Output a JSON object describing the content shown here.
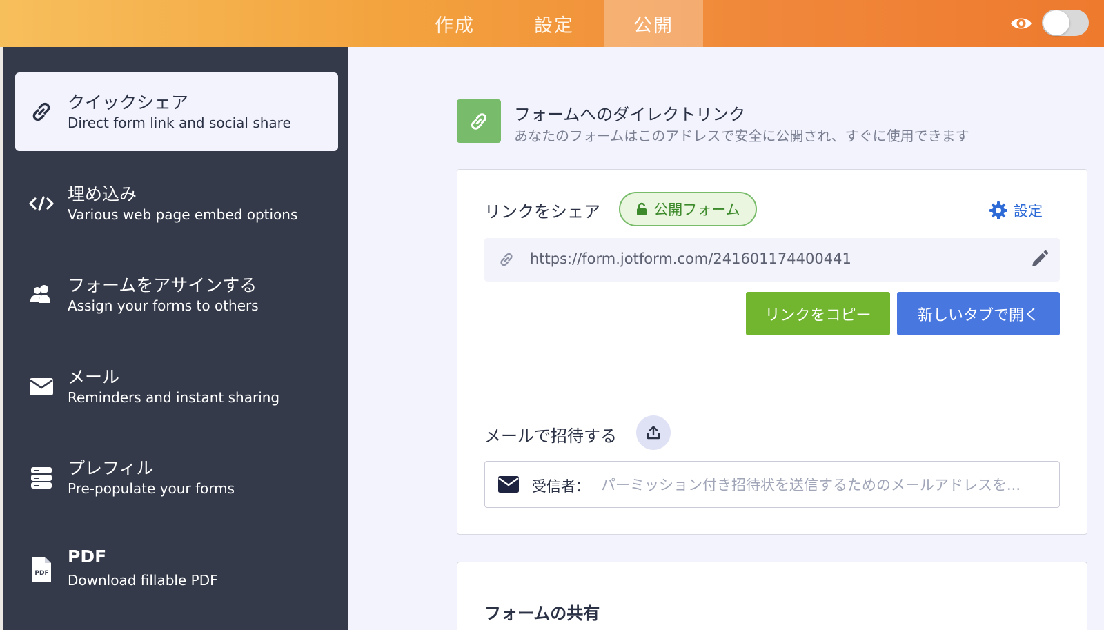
{
  "topbar": {
    "tabs": [
      {
        "label": "作成",
        "active": false
      },
      {
        "label": "設定",
        "active": false
      },
      {
        "label": "公開",
        "active": true
      }
    ],
    "preview_icon": "eye-icon",
    "toggle_on": false
  },
  "sidebar": {
    "items": [
      {
        "title": "クイックシェア",
        "desc": "Direct form link and social share",
        "icon": "link-icon",
        "active": true
      },
      {
        "title": "埋め込み",
        "desc": "Various web page embed options",
        "icon": "code-icon",
        "active": false
      },
      {
        "title": "フォームをアサインする",
        "desc": "Assign your forms to others",
        "icon": "users-icon",
        "active": false
      },
      {
        "title": "メール",
        "desc": "Reminders and instant sharing",
        "icon": "envelope-icon",
        "active": false
      },
      {
        "title": "プレフィル",
        "desc": "Pre-populate your forms",
        "icon": "stack-icon",
        "active": false
      },
      {
        "title": "PDF",
        "desc": "Download fillable PDF",
        "icon": "pdf-file-icon",
        "active": false
      }
    ]
  },
  "header": {
    "title": "フォームへのダイレクトリンク",
    "subtitle": "あなたのフォームはこのアドレスで安全に公開され、すぐに使用できます"
  },
  "share": {
    "label": "リンクをシェア",
    "badge": "公開フォーム",
    "settings": "設定",
    "url": "https://form.jotform.com/241601174400441",
    "copy_button": "リンクをコピー",
    "open_button": "新しいタブで開く"
  },
  "invite": {
    "label": "メールで招待する",
    "recipient_label": "受信者：",
    "placeholder": "パーミッション付き招待状を送信するためのメールアドレスを..."
  },
  "sharing_section": {
    "title": "フォームの共有"
  },
  "colors": {
    "accent_orange": "#f0873a",
    "sidebar_bg": "#343a4a",
    "green": "#72b52f",
    "blue": "#4977e0",
    "link_blue": "#2e6bd6"
  }
}
